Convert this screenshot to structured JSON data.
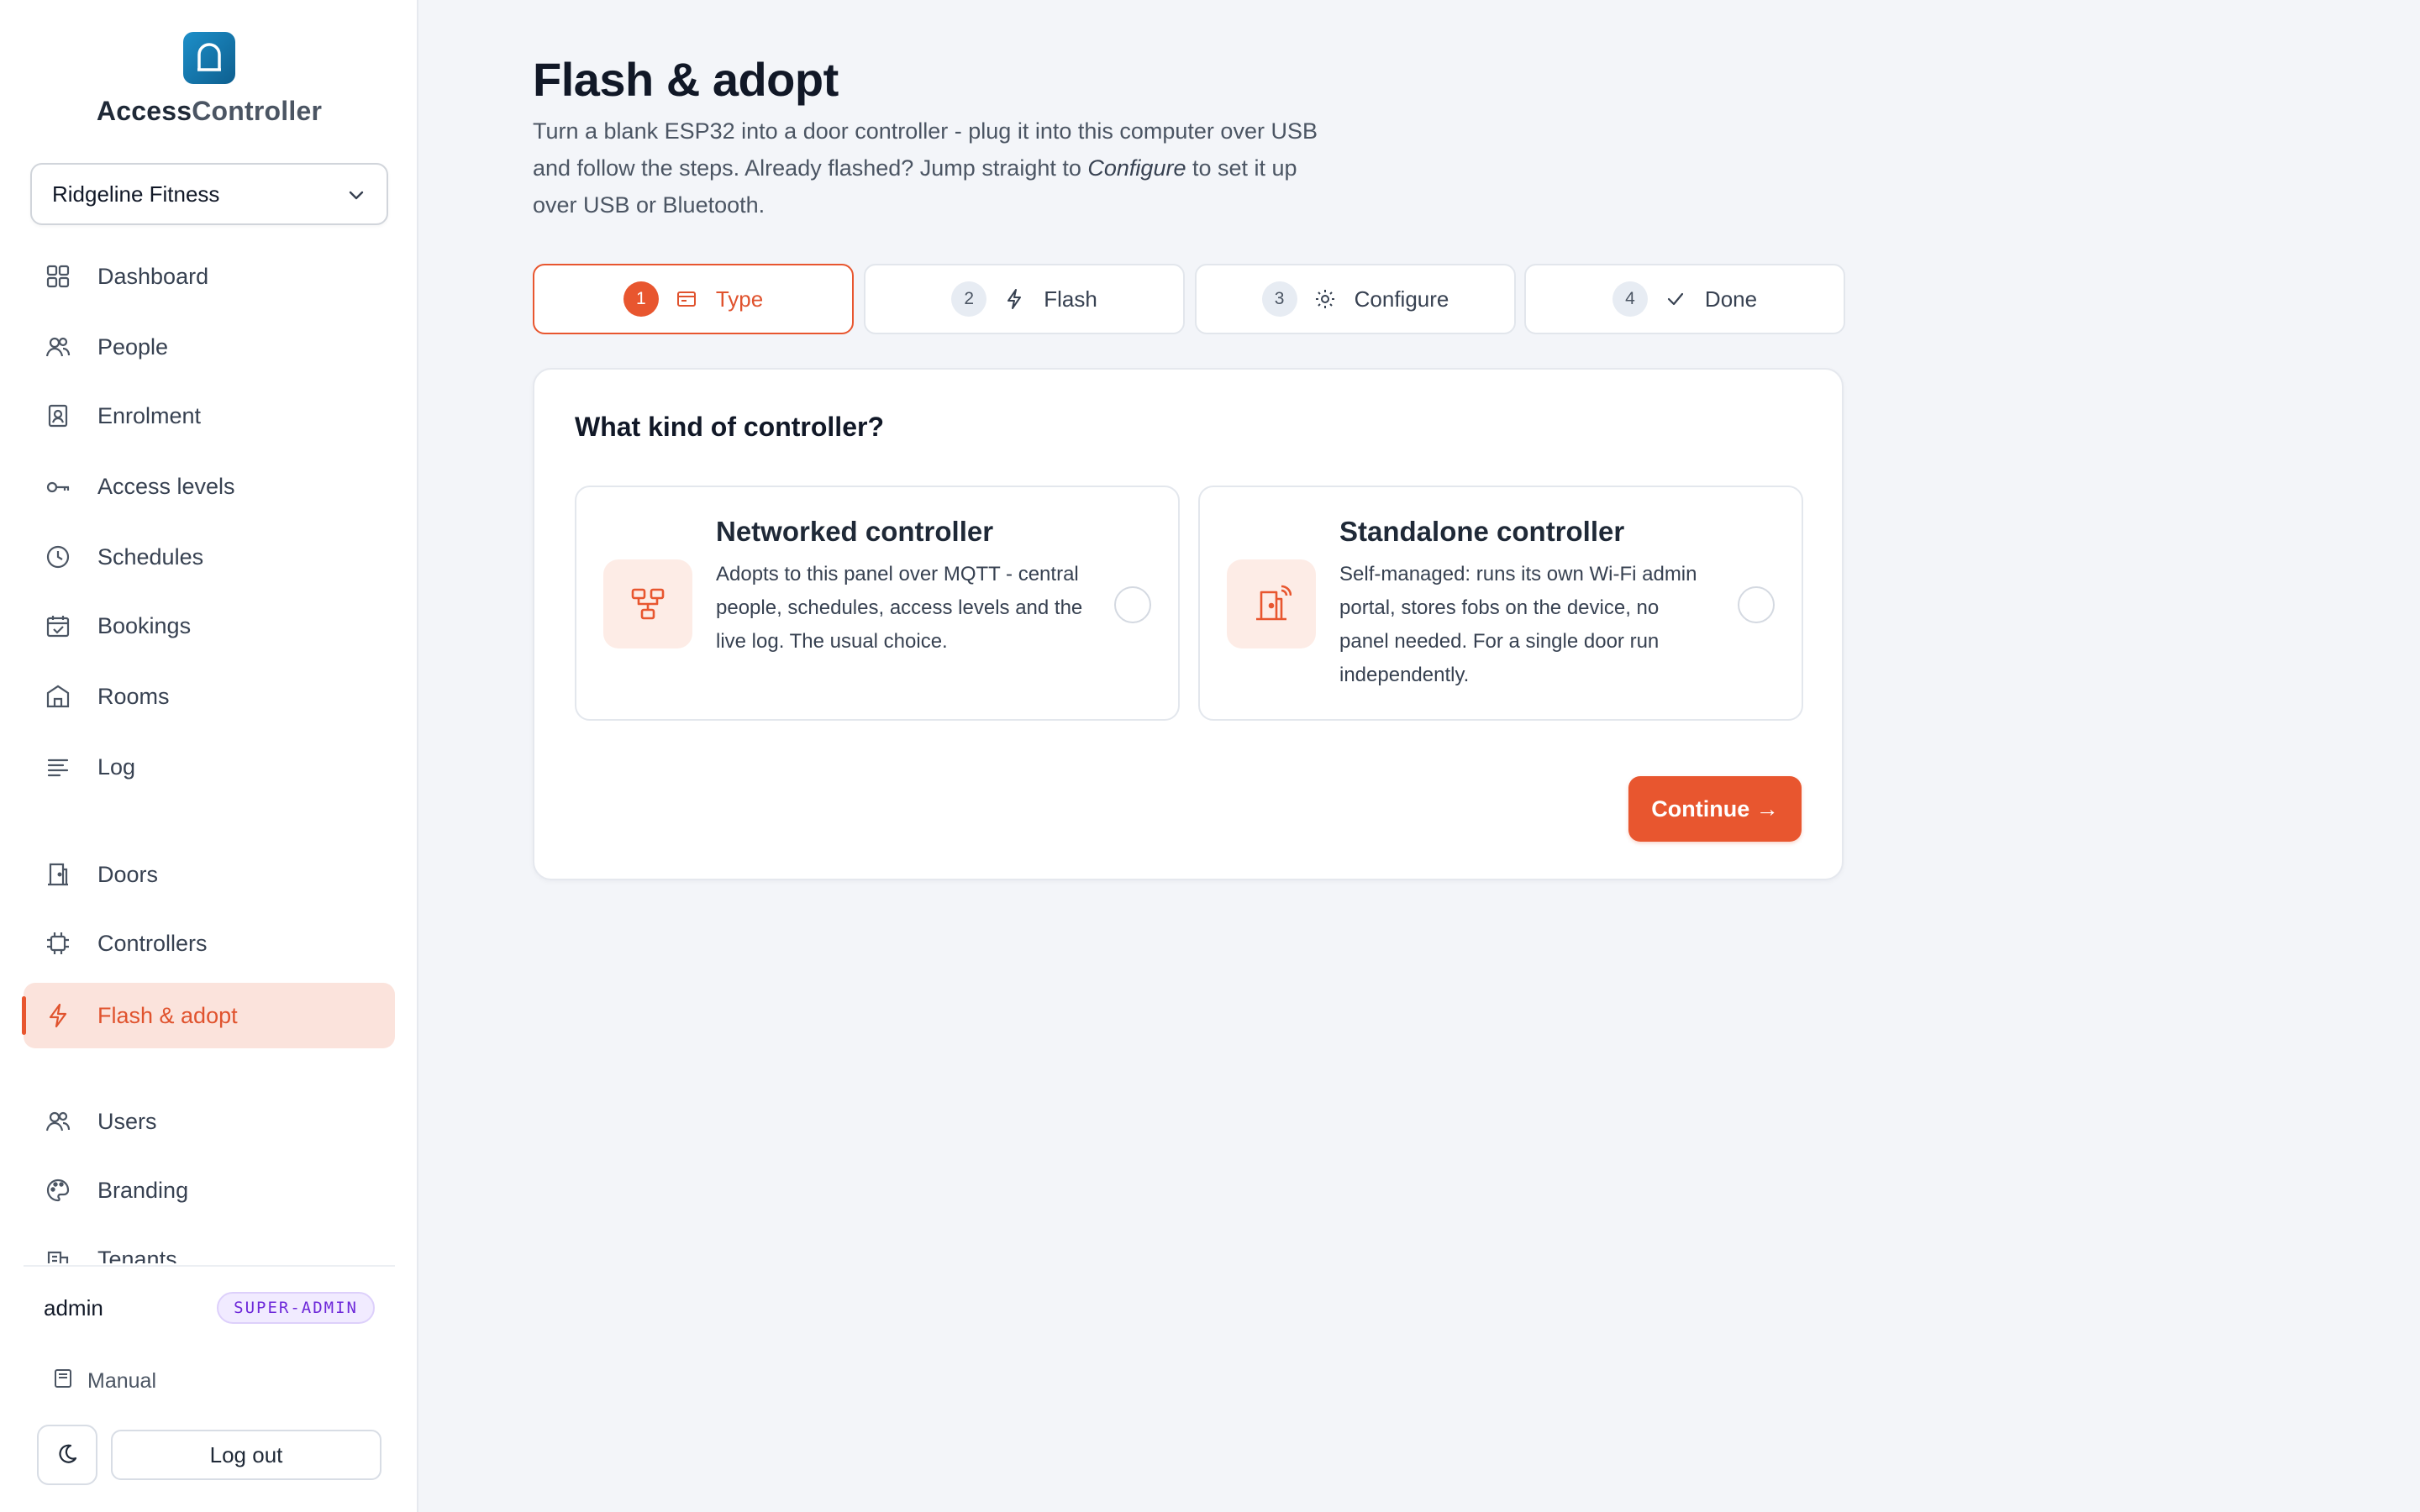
{
  "brand": {
    "part1": "Access",
    "part2": "Controller"
  },
  "tenant": {
    "selected": "Ridgeline Fitness"
  },
  "sidebar": {
    "items": [
      {
        "label": "Dashboard",
        "icon": "grid-icon"
      },
      {
        "label": "People",
        "icon": "users-icon"
      },
      {
        "label": "Enrolment",
        "icon": "id-badge-icon"
      },
      {
        "label": "Access levels",
        "icon": "key-icon"
      },
      {
        "label": "Schedules",
        "icon": "clock-icon"
      },
      {
        "label": "Bookings",
        "icon": "calendar-check-icon"
      },
      {
        "label": "Rooms",
        "icon": "building-icon"
      },
      {
        "label": "Log",
        "icon": "list-icon"
      },
      {
        "label": "Doors",
        "icon": "door-icon"
      },
      {
        "label": "Controllers",
        "icon": "chip-icon"
      },
      {
        "label": "Flash & adopt",
        "icon": "lightning-icon",
        "active": true
      },
      {
        "label": "Users",
        "icon": "users-icon"
      },
      {
        "label": "Branding",
        "icon": "palette-icon"
      },
      {
        "label": "Tenants",
        "icon": "buildings-icon"
      }
    ],
    "user": {
      "name": "admin",
      "role": "SUPER-ADMIN"
    },
    "manual_label": "Manual",
    "logout_label": "Log out"
  },
  "main": {
    "title": "Flash & adopt",
    "desc_1": "Turn a blank ESP32 into a door controller - plug it into this computer over USB and follow the steps. Already flashed? Jump straight to ",
    "desc_em": "Configure",
    "desc_2": " to set it up over USB or Bluetooth.",
    "steps": [
      {
        "num": "1",
        "label": "Type",
        "icon": "card-icon",
        "active": true
      },
      {
        "num": "2",
        "label": "Flash",
        "icon": "lightning-icon"
      },
      {
        "num": "3",
        "label": "Configure",
        "icon": "gear-icon"
      },
      {
        "num": "4",
        "label": "Done",
        "icon": "check-icon"
      }
    ],
    "question": "What kind of controller?",
    "options": [
      {
        "title": "Networked controller",
        "desc": "Adopts to this panel over MQTT - central people, schedules, access levels and the live log. The usual choice.",
        "icon": "network-icon"
      },
      {
        "title": "Standalone controller",
        "desc": "Self-managed: runs its own Wi-Fi admin portal, stores fobs on the device, no panel needed. For a single door run independently.",
        "icon": "standalone-door-icon"
      }
    ],
    "continue_label": "Continue →"
  },
  "colors": {
    "accent": "#e8562f",
    "accent_soft": "#fbe3dc",
    "brand_logo": "#1d8fc9",
    "role_badge": "#6d28d9"
  }
}
